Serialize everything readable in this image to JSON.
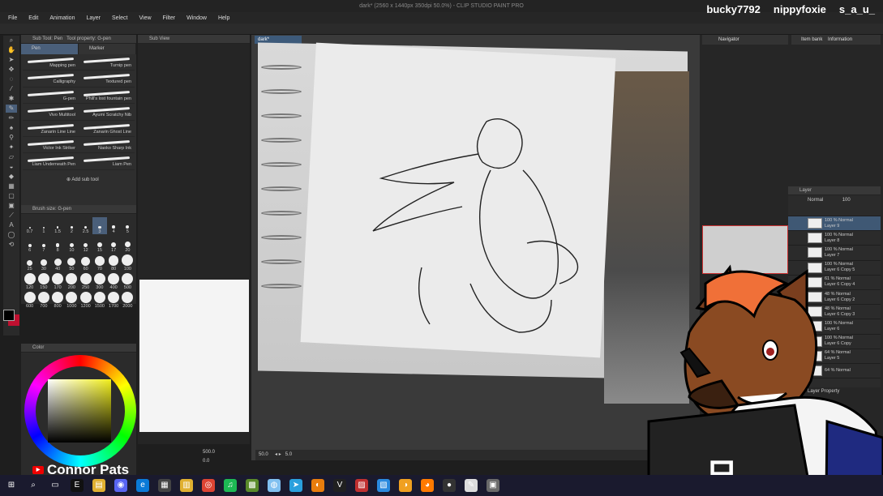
{
  "window": {
    "title": "dark* (2560 x 1440px 350dpi 50.0%) - CLIP STUDIO PAINT PRO"
  },
  "menu": [
    "File",
    "Edit",
    "Animation",
    "Layer",
    "Select",
    "View",
    "Filter",
    "Window",
    "Help"
  ],
  "overlay_usernames": [
    "bucky7792",
    "nippyfoxie",
    "s_a_u_"
  ],
  "overlay_channel": "Connor Pats",
  "subtool": {
    "header": "Sub Tool: Pen",
    "header2": "Tool property: G-pen",
    "tabs": [
      "Pen",
      "Marker"
    ],
    "brushes": [
      "Mapping pen",
      "Turnip pen",
      "Calligraphy",
      "Textured pen",
      "G-pen",
      "Phill's lost fountain pen",
      "Vivo Multitool",
      "Ayumi Scratchy Nib",
      "Zanarin Line Line",
      "Zanarin Ghost Line",
      "Victor Ink Striker",
      "Naoko Sharp Ink",
      "Liam Underneath Pen",
      "Liam Pen"
    ],
    "add": "Add sub tool"
  },
  "brushsize": {
    "header": "Brush size: G-pen",
    "sizes": [
      "0.7",
      "1",
      "1.5",
      "2",
      "2.5",
      "3",
      "4",
      "5",
      "6",
      "7",
      "8",
      "10",
      "12",
      "15",
      "17",
      "20",
      "25",
      "30",
      "40",
      "50",
      "60",
      "70",
      "80",
      "100",
      "120",
      "150",
      "170",
      "200",
      "250",
      "300",
      "400",
      "500",
      "600",
      "700",
      "800",
      "1000",
      "1200",
      "1500",
      "1700",
      "2000"
    ],
    "selected": "3"
  },
  "color_panel": {
    "header": "Color"
  },
  "subview": {
    "header": "Sub View"
  },
  "canvas": {
    "tab": "dark*",
    "zoom": "50.0",
    "rotation": "5.0"
  },
  "subview_footer": {
    "zoom": "500.0",
    "rotation": "0.0"
  },
  "navigator": {
    "header": "Navigator"
  },
  "itembank": {
    "header": "Item bank",
    "tab2": "Information"
  },
  "layer_panel": {
    "header": "Layer",
    "blend": "Normal",
    "opacity": "100",
    "layers": [
      {
        "opacity": "100 %",
        "blend": "Normal",
        "name": "Layer 9",
        "selected": true
      },
      {
        "opacity": "100 %",
        "blend": "Normal",
        "name": "Layer 8"
      },
      {
        "opacity": "100 %",
        "blend": "Normal",
        "name": "Layer 7"
      },
      {
        "opacity": "100 %",
        "blend": "Normal",
        "name": "Layer 6 Copy 5"
      },
      {
        "opacity": "61 %",
        "blend": "Normal",
        "name": "Layer 6 Copy 4"
      },
      {
        "opacity": "48 %",
        "blend": "Normal",
        "name": "Layer 6 Copy 2"
      },
      {
        "opacity": "48 %",
        "blend": "Normal",
        "name": "Layer 6 Copy 3"
      },
      {
        "opacity": "100 %",
        "blend": "Normal",
        "name": "Layer 6"
      },
      {
        "opacity": "100 %",
        "blend": "Normal",
        "name": "Layer 6 Copy"
      },
      {
        "opacity": "64 %",
        "blend": "Normal",
        "name": "Layer 5"
      },
      {
        "opacity": "64 %",
        "blend": "Normal",
        "name": ""
      }
    ],
    "property": "Layer Property"
  },
  "colors": {
    "fg": "#000000",
    "bg": "#c01030",
    "accent": "#3f5874"
  },
  "taskbar_icons": [
    "windows-icon",
    "search-icon",
    "task-view-icon",
    "epic-icon",
    "file-explorer-icon",
    "discord-icon",
    "edge-icon",
    "ms-store-icon",
    "folder-icon",
    "chrome-icon",
    "spotify-icon",
    "minecraft-icon",
    "streamlabs-icon",
    "telegram-icon",
    "blender-icon",
    "vrchat-icon",
    "paint-icon",
    "photos-icon",
    "overwatch-icon",
    "firefox-icon",
    "obs-icon",
    "clip-studio-icon",
    "gallery-icon"
  ]
}
